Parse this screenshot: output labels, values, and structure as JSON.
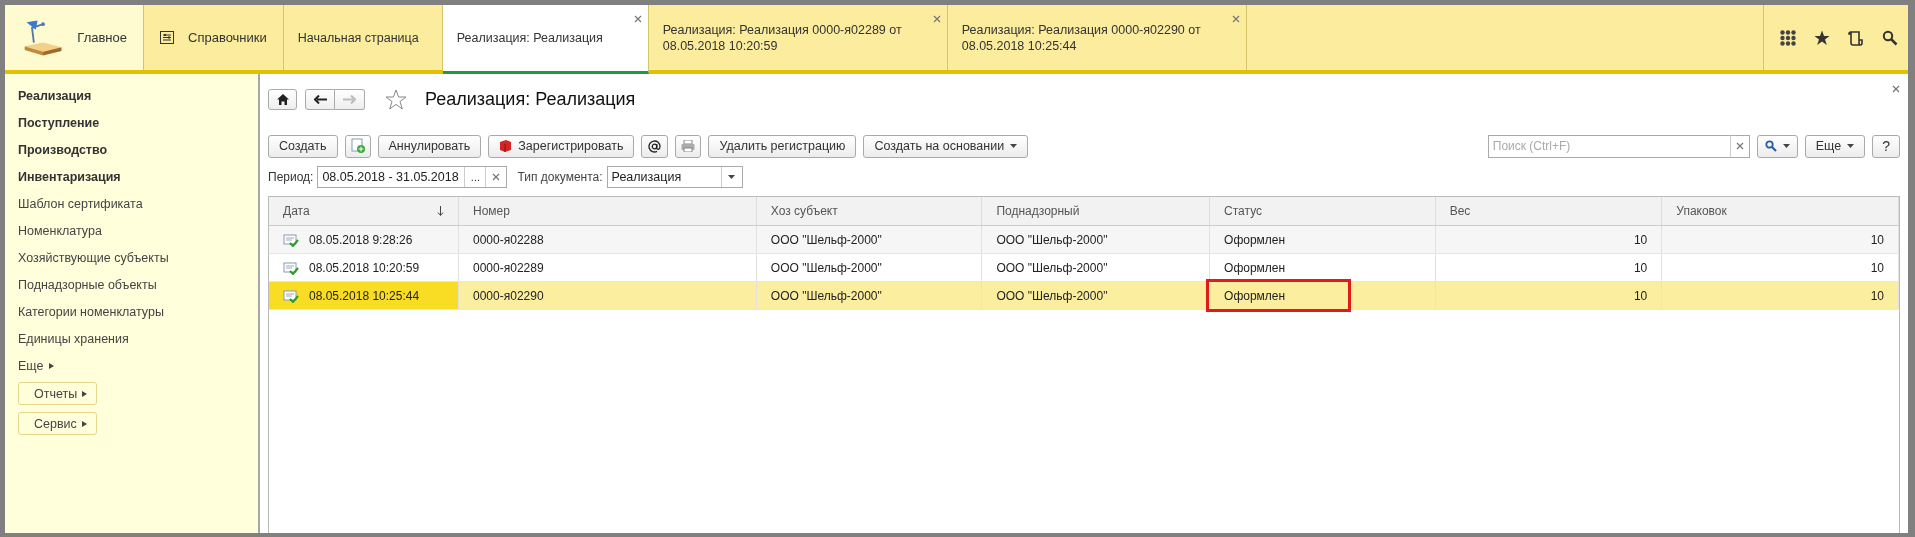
{
  "top_bar": {
    "sections": [
      {
        "label": "Главное",
        "kind": "home"
      },
      {
        "label": "Справочники",
        "kind": "refs"
      }
    ],
    "tabs": [
      {
        "label": "Начальная страница",
        "selected": false,
        "closable": false
      },
      {
        "label": "Реализация: Реализация",
        "selected": true,
        "closable": true
      },
      {
        "label": "Реализация: Реализация 0000-я02289 от 08.05.2018 10:20:59",
        "selected": false,
        "closable": true
      },
      {
        "label": "Реализация: Реализация 0000-я02290 от 08.05.2018 10:25:44",
        "selected": false,
        "closable": true
      }
    ]
  },
  "sidebar": {
    "items": [
      {
        "label": "Реализация",
        "kind": "section"
      },
      {
        "label": "Поступление",
        "kind": "section"
      },
      {
        "label": "Производство",
        "kind": "section"
      },
      {
        "label": "Инвентаризация",
        "kind": "section"
      },
      {
        "label": "Шаблон сертификата",
        "kind": "link"
      },
      {
        "label": "Номенклатура",
        "kind": "link"
      },
      {
        "label": "Хозяйствующие субъекты",
        "kind": "link"
      },
      {
        "label": "Поднадзорные объекты",
        "kind": "link"
      },
      {
        "label": "Категории номенклатуры",
        "kind": "link"
      },
      {
        "label": "Единицы хранения",
        "kind": "link"
      },
      {
        "label": "Еще",
        "kind": "more"
      },
      {
        "label": "Отчеты",
        "kind": "button"
      },
      {
        "label": "Сервис",
        "kind": "button"
      }
    ]
  },
  "form": {
    "title": "Реализация: Реализация",
    "toolbar": [
      {
        "label": "Создать",
        "kind": "text"
      },
      {
        "kind": "copy"
      },
      {
        "label": "Аннулировать",
        "kind": "text"
      },
      {
        "label": "Зарегистрировать",
        "kind": "register"
      },
      {
        "kind": "mail"
      },
      {
        "kind": "print"
      },
      {
        "label": "Удалить регистрацию",
        "kind": "text"
      },
      {
        "label": "Создать на основании",
        "kind": "dropdown"
      }
    ],
    "search": {
      "placeholder": "Поиск (Ctrl+F)"
    },
    "more_button": "Еще",
    "help_button": "?",
    "period": {
      "label": "Период:",
      "value": "08.05.2018 - 31.05.2018",
      "select_button": "..."
    },
    "doc_type": {
      "label": "Тип документа:",
      "value": "Реализация"
    },
    "table": {
      "columns": [
        {
          "title": "Дата",
          "sorted": true
        },
        {
          "title": "Номер",
          "sorted": false
        },
        {
          "title": "Хоз субъект",
          "sorted": false
        },
        {
          "title": "Поднадзорный",
          "sorted": false
        },
        {
          "title": "Статус",
          "sorted": false
        },
        {
          "title": "Вес",
          "sorted": false
        },
        {
          "title": "Упаковок",
          "sorted": false
        }
      ],
      "rows": [
        {
          "selected": false,
          "status_outlined": false,
          "cells": [
            "08.05.2018 9:28:26",
            "0000-я02288",
            "ООО \"Шельф-2000\"",
            "ООО \"Шельф-2000\"",
            "Оформлен",
            "10",
            "10"
          ]
        },
        {
          "selected": false,
          "status_outlined": false,
          "cells": [
            "08.05.2018 10:20:59",
            "0000-я02289",
            "ООО \"Шельф-2000\"",
            "ООО \"Шельф-2000\"",
            "Оформлен",
            "10",
            "10"
          ]
        },
        {
          "selected": true,
          "status_outlined": true,
          "cells": [
            "08.05.2018 10:25:44",
            "0000-я02290",
            "ООО \"Шельф-2000\"",
            "ООО \"Шельф-2000\"",
            "Оформлен",
            "10",
            "10"
          ]
        }
      ]
    }
  }
}
